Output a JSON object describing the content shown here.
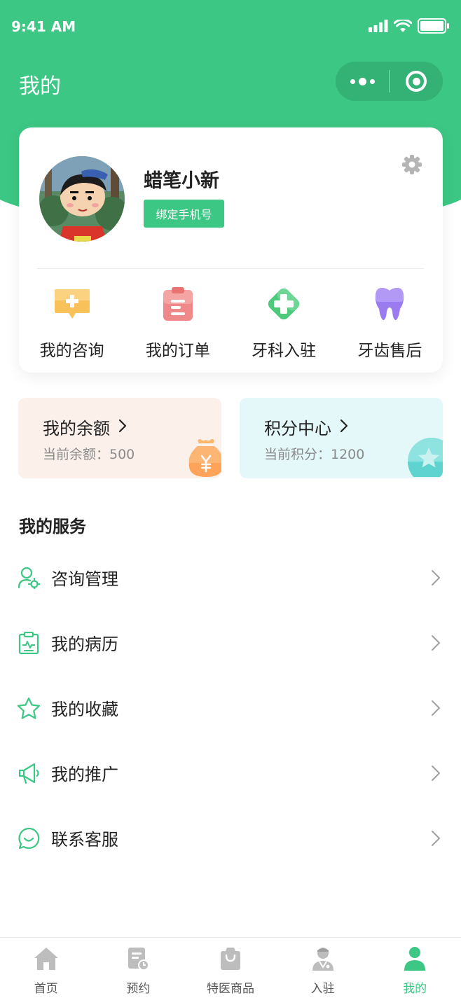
{
  "status_bar": {
    "time": "9:41 AM"
  },
  "nav": {
    "title": "我的"
  },
  "profile": {
    "username": "蜡笔小新",
    "bind_phone_label": "绑定手机号"
  },
  "quick_actions": [
    {
      "label": "我的咨询",
      "icon": "consult-message-icon",
      "color": "#f9c15a"
    },
    {
      "label": "我的订单",
      "icon": "order-clipboard-icon",
      "color": "#f08a8a"
    },
    {
      "label": "牙科入驻",
      "icon": "medical-cross-icon",
      "color": "#4cc97b"
    },
    {
      "label": "牙齿售后",
      "icon": "tooth-icon",
      "color": "#9b7cf0"
    }
  ],
  "wallet": {
    "balance": {
      "title": "我的余额",
      "subtitle": "当前余额：500"
    },
    "points": {
      "title": "积分中心",
      "subtitle": "当前积分：1200"
    }
  },
  "services": {
    "title": "我的服务",
    "items": [
      {
        "label": "咨询管理",
        "icon": "user-settings-icon"
      },
      {
        "label": "我的病历",
        "icon": "medical-record-icon"
      },
      {
        "label": "我的收藏",
        "icon": "star-icon"
      },
      {
        "label": "我的推广",
        "icon": "megaphone-icon"
      },
      {
        "label": "联系客服",
        "icon": "chat-bubble-icon"
      }
    ]
  },
  "tabbar": [
    {
      "label": "首页",
      "icon": "home-icon",
      "active": false
    },
    {
      "label": "预约",
      "icon": "appointment-icon",
      "active": false
    },
    {
      "label": "特医商品",
      "icon": "shopping-bag-icon",
      "active": false
    },
    {
      "label": "入驻",
      "icon": "doctor-icon",
      "active": false
    },
    {
      "label": "我的",
      "icon": "profile-icon",
      "active": true
    }
  ],
  "colors": {
    "brand_green": "#3cc784",
    "balance_bg": "#fcf0ea",
    "points_bg": "#e5f8f9",
    "tab_inactive": "#bdbdbd"
  }
}
